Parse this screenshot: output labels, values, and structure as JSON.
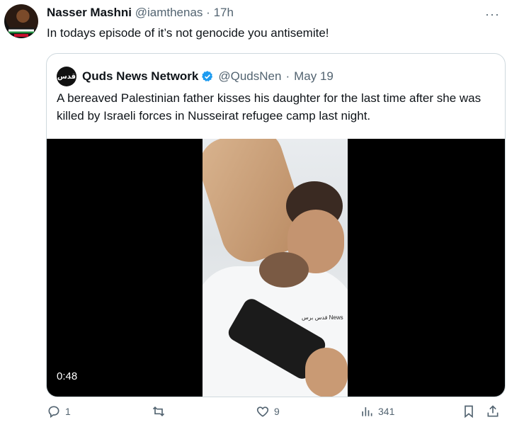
{
  "tweet": {
    "author_name": "Nasser Mashni",
    "author_handle": "@iamthenas",
    "separator": "·",
    "time": "17h",
    "text": "In todays episode of it’s not genocide you antisemite!"
  },
  "more_menu": "···",
  "quoted": {
    "logo_text": "قدس",
    "author_name": "Quds News Network",
    "author_handle": "@QudsNen",
    "separator": "·",
    "date": "May 19",
    "text": "A bereaved Palestinian father kisses his daughter for the last time after she was killed by Israeli forces in Nusseirat refugee camp last night.",
    "video": {
      "duration": "0:48",
      "watermark": "قدس برس News"
    }
  },
  "actions": {
    "reply_count": "1",
    "retweet_count": "",
    "like_count": "9",
    "views_count": "341"
  },
  "colors": {
    "text_primary": "#0f1419",
    "text_secondary": "#536471",
    "border": "#cfd9de",
    "verified": "#1d9bf0"
  },
  "icons": [
    "avatar",
    "more-icon",
    "verified-icon",
    "reply-icon",
    "retweet-icon",
    "like-icon",
    "views-icon",
    "bookmark-icon",
    "share-icon"
  ]
}
